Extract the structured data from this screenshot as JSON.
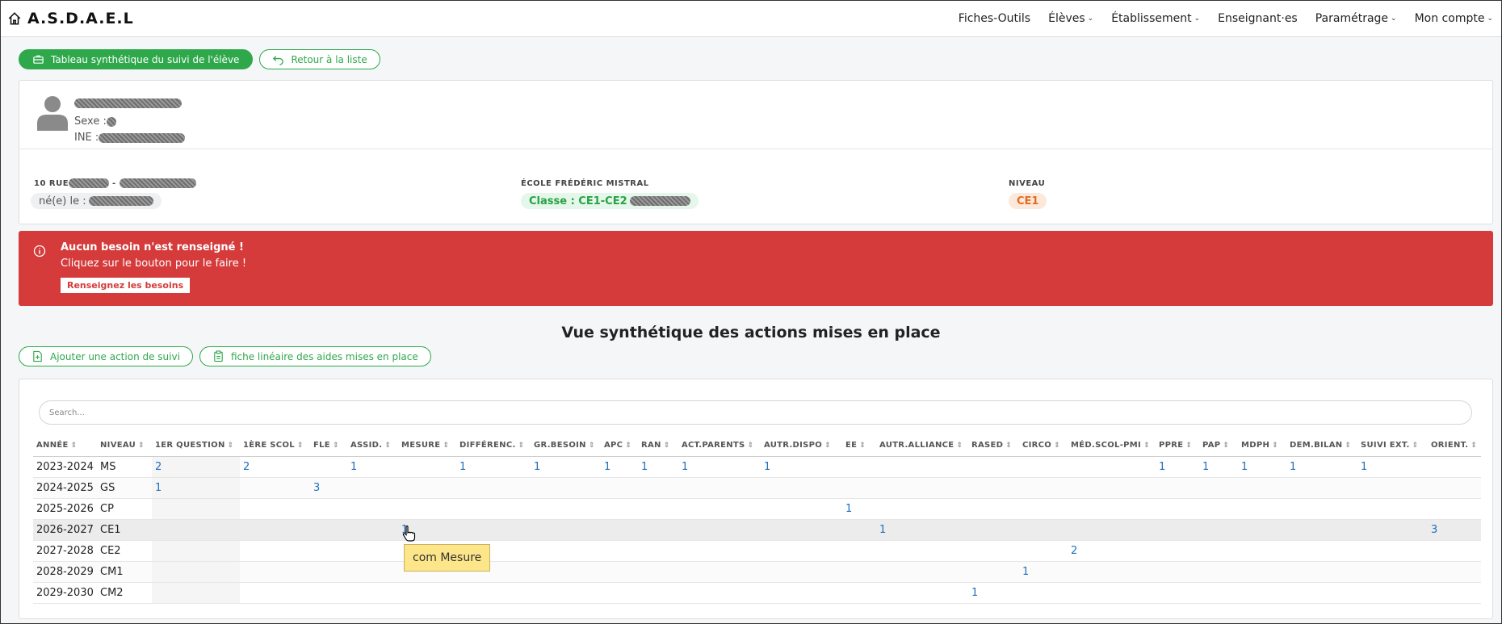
{
  "brand": "A.S.D.A.E.L",
  "nav": [
    {
      "label": "Fiches-Outils",
      "chevron": false
    },
    {
      "label": "Élèves",
      "chevron": true
    },
    {
      "label": "Établissement",
      "chevron": true
    },
    {
      "label": "Enseignant·es",
      "chevron": false
    },
    {
      "label": "Paramétrage",
      "chevron": true
    },
    {
      "label": "Mon compte",
      "chevron": true
    }
  ],
  "buttons": {
    "synthese": "Tableau synthétique du suivi de l'élève",
    "retour": "Retour à la liste",
    "ajouter": "Ajouter une action de suivi",
    "fiche": "fiche linéaire des aides mises en place"
  },
  "student": {
    "sexe_label": "Sexe :",
    "ine_label": "INE :",
    "address_prefix": "10 RUE",
    "born_label": "né(e) le :",
    "school_head": "ÉCOLE FRÉDÉRIC MISTRAL",
    "class_label": "Classe : CE1-CE2",
    "niveau_head": "NIVEAU",
    "niveau_value": "CE1"
  },
  "alert": {
    "title": "Aucun besoin n'est renseigné !",
    "text": "Cliquez sur le bouton pour le faire !",
    "button": "Renseignez les besoins",
    "color": "#d53b3b"
  },
  "section_title": "Vue synthétique des actions mises en place",
  "search_placeholder": "Search...",
  "table": {
    "columns": [
      "ANNÉE",
      "NIVEAU",
      "1ER QUESTION",
      "1ÈRE SCOL",
      "FLE",
      "ASSID.",
      "MESURE",
      "DIFFÉRENC.",
      "GR.BESOIN",
      "APC",
      "RAN",
      "ACT.PARENTS",
      "AUTR.DISPO",
      "EE",
      "AUTR.ALLIANCE",
      "RASED",
      "CIRCO",
      "MÉD.SCOL-PMI",
      "PPRE",
      "PAP",
      "MDPH",
      "DEM.BILAN",
      "SUIVI EXT.",
      "ORIENT."
    ],
    "rows": [
      [
        "2023-2024",
        "MS",
        "2",
        "2",
        "",
        "1",
        "",
        "1",
        "1",
        "1",
        "1",
        "1",
        "1",
        "",
        "",
        "",
        "",
        "",
        "1",
        "1",
        "1",
        "1",
        "1",
        ""
      ],
      [
        "2024-2025",
        "GS",
        "1",
        "",
        "3",
        "",
        "",
        "",
        "",
        "",
        "",
        "",
        "",
        "",
        "",
        "",
        "",
        "",
        "",
        "",
        "",
        "",
        "",
        ""
      ],
      [
        "2025-2026",
        "CP",
        "",
        "",
        "",
        "",
        "",
        "",
        "",
        "",
        "",
        "",
        "",
        "1",
        "",
        "",
        "",
        "",
        "",
        "",
        "",
        "",
        "",
        ""
      ],
      [
        "2026-2027",
        "CE1",
        "",
        "",
        "",
        "",
        "1",
        "",
        "",
        "",
        "",
        "",
        "",
        "",
        "1",
        "",
        "",
        "",
        "",
        "",
        "",
        "",
        "",
        "3"
      ],
      [
        "2027-2028",
        "CE2",
        "",
        "",
        "",
        "",
        "",
        "",
        "",
        "",
        "",
        "",
        "",
        "",
        "",
        "",
        "",
        "2",
        "",
        "",
        "",
        "",
        "",
        ""
      ],
      [
        "2028-2029",
        "CM1",
        "",
        "",
        "",
        "",
        "",
        "",
        "",
        "",
        "",
        "",
        "",
        "",
        "",
        "",
        "1",
        "",
        "",
        "",
        "",
        "",
        "",
        ""
      ],
      [
        "2029-2030",
        "CM2",
        "",
        "",
        "",
        "",
        "",
        "",
        "",
        "",
        "",
        "",
        "",
        "",
        "",
        "1",
        "",
        "",
        "",
        "",
        "",
        "",
        "",
        ""
      ]
    ]
  },
  "tooltip": "com Mesure",
  "colors": {
    "accent": "#2ea84b",
    "link": "#1f6fbf",
    "alert": "#d53b3b",
    "tooltip": "#fde68a"
  }
}
